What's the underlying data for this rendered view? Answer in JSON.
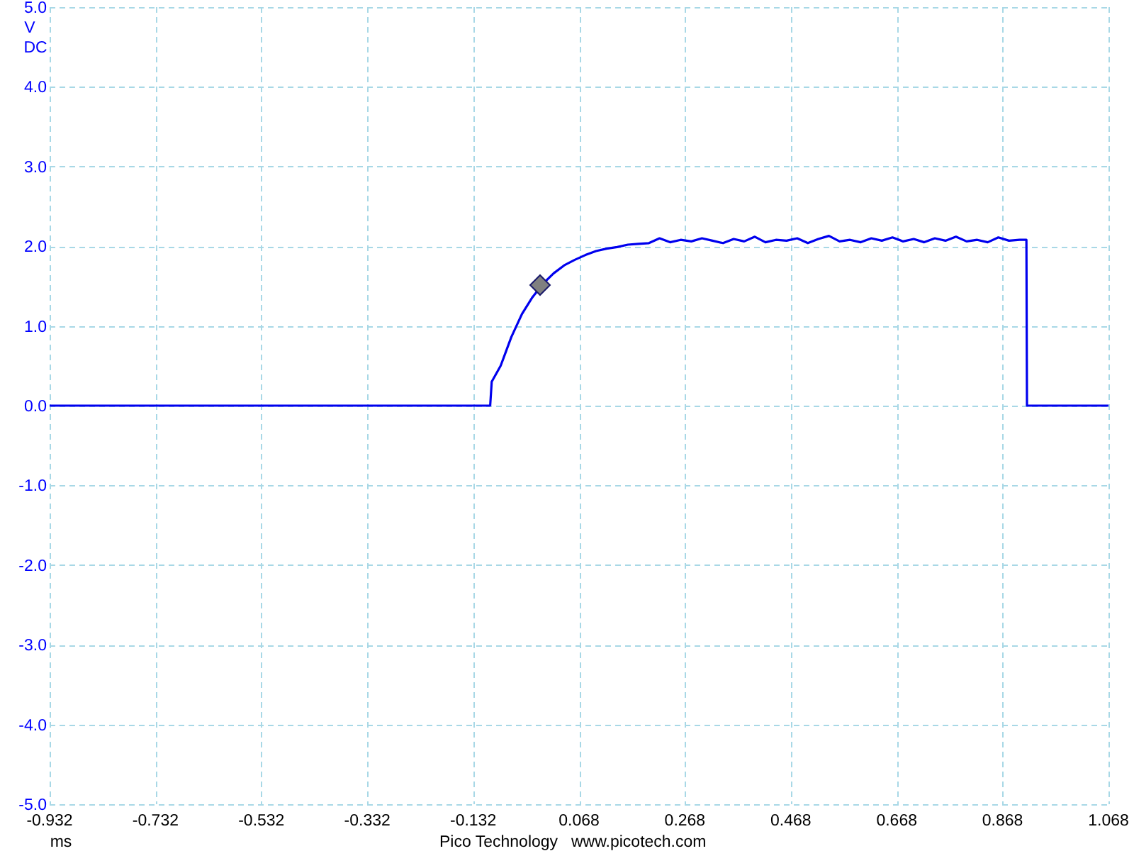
{
  "chart_data": {
    "type": "line",
    "xlabel": "ms",
    "ylabel": "V",
    "xticks": [
      {
        "value": -0.932,
        "label": "-0.932"
      },
      {
        "value": -0.732,
        "label": "-0.732"
      },
      {
        "value": -0.532,
        "label": "-0.532"
      },
      {
        "value": -0.332,
        "label": "-0.332"
      },
      {
        "value": -0.132,
        "label": "-0.132"
      },
      {
        "value": 0.068,
        "label": "0.068"
      },
      {
        "value": 0.268,
        "label": "0.268"
      },
      {
        "value": 0.468,
        "label": "0.468"
      },
      {
        "value": 0.668,
        "label": "0.668"
      },
      {
        "value": 0.868,
        "label": "0.868"
      },
      {
        "value": 1.068,
        "label": "1.068"
      }
    ],
    "yticks": [
      {
        "value": 5,
        "label": "5.0"
      },
      {
        "value": 4,
        "label": "4.0"
      },
      {
        "value": 3,
        "label": "3.0"
      },
      {
        "value": 2,
        "label": "2.0"
      },
      {
        "value": 1,
        "label": "1.0"
      },
      {
        "value": 0,
        "label": "0.0"
      },
      {
        "value": -1,
        "label": "-1.0"
      },
      {
        "value": -2,
        "label": "-2.0"
      },
      {
        "value": -3,
        "label": "-3.0"
      },
      {
        "value": -4,
        "label": "-4.0"
      },
      {
        "value": -5,
        "label": "-5.0"
      }
    ],
    "xlim": [
      -0.932,
      1.068
    ],
    "ylim": [
      -5,
      5
    ],
    "x": [
      -0.932,
      -0.1,
      -0.097,
      -0.08,
      -0.06,
      -0.04,
      -0.02,
      0.0,
      0.02,
      0.04,
      0.06,
      0.08,
      0.1,
      0.12,
      0.14,
      0.16,
      0.18,
      0.2,
      0.22,
      0.24,
      0.26,
      0.28,
      0.3,
      0.32,
      0.34,
      0.36,
      0.38,
      0.4,
      0.42,
      0.44,
      0.46,
      0.48,
      0.5,
      0.52,
      0.54,
      0.56,
      0.58,
      0.6,
      0.62,
      0.64,
      0.66,
      0.68,
      0.7,
      0.72,
      0.74,
      0.76,
      0.78,
      0.8,
      0.82,
      0.84,
      0.86,
      0.88,
      0.9,
      0.913,
      0.914,
      1.068
    ],
    "grid": true,
    "series": [
      {
        "color": "#0000ee",
        "values": [
          0,
          0,
          0.3,
          0.5,
          0.86,
          1.15,
          1.36,
          1.53,
          1.66,
          1.76,
          1.83,
          1.89,
          1.94,
          1.97,
          1.99,
          2.02,
          2.03,
          2.04,
          2.1,
          2.05,
          2.08,
          2.06,
          2.1,
          2.07,
          2.04,
          2.09,
          2.06,
          2.12,
          2.05,
          2.08,
          2.07,
          2.1,
          2.04,
          2.09,
          2.13,
          2.06,
          2.08,
          2.05,
          2.1,
          2.07,
          2.11,
          2.06,
          2.09,
          2.05,
          2.1,
          2.07,
          2.12,
          2.06,
          2.08,
          2.05,
          2.11,
          2.07,
          2.08,
          2.08,
          0,
          0
        ]
      }
    ]
  },
  "coupling": "DC",
  "footer": [
    "Pico Technology",
    "www.picotech.com"
  ]
}
